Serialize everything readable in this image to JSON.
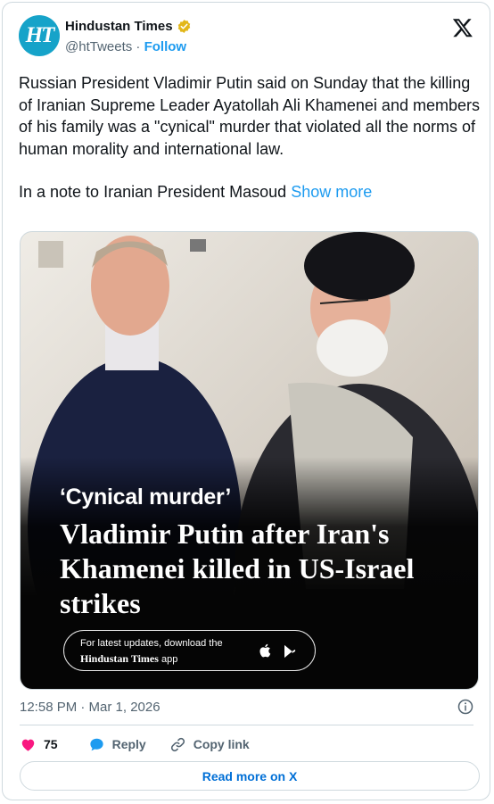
{
  "header": {
    "avatar_text": "HT",
    "account_name": "Hindustan Times",
    "handle": "@htTweets",
    "separator": " · ",
    "follow_label": "Follow",
    "verified_color": "#e2b719",
    "avatar_color": "#16a3c9"
  },
  "tweet": {
    "paragraph1": "Russian President Vladimir Putin said on Sunday that the killing of Iranian Supreme Leader Ayatollah Ali Khamenei and members of his family was a \"cynical\" murder that violated all the norms of human morality and international law.",
    "paragraph2": "In a note to Iranian President Masoud ",
    "show_more": "Show more"
  },
  "media": {
    "kicker": "‘Cynical murder’",
    "headline": "Vladimir Putin after Iran's Khamenei killed in US-Israel strikes",
    "promo_line1": "For latest updates, download the",
    "promo_brand": "Hindustan Times",
    "promo_suffix": " app",
    "icons": [
      "apple-icon",
      "play-store-icon"
    ]
  },
  "meta": {
    "timestamp": "12:58 PM · Mar 1, 2026"
  },
  "actions": {
    "likes": "75",
    "reply_label": "Reply",
    "copy_link_label": "Copy link",
    "like_color": "#f91880",
    "reply_color": "#1d9bf0"
  },
  "footer": {
    "read_more_label": "Read more on X"
  }
}
